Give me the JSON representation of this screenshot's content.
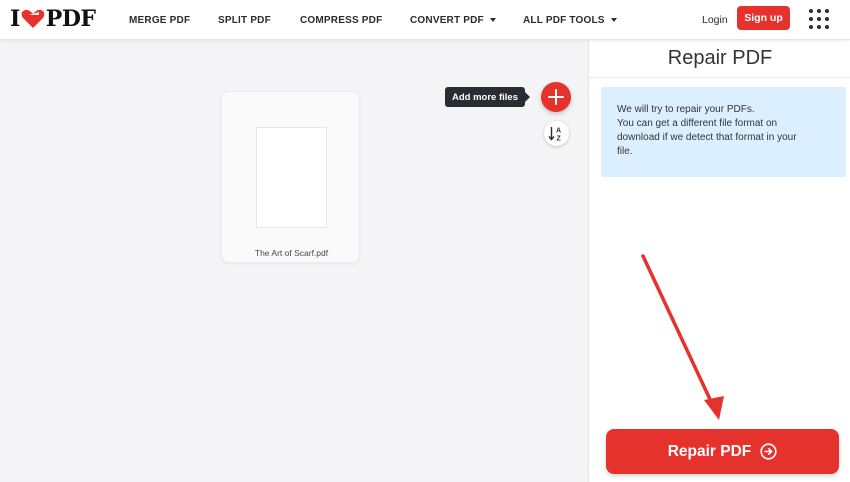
{
  "brand": {
    "logo_left": "I",
    "logo_right": "PDF",
    "accent_color": "#e5322d"
  },
  "nav": {
    "items": [
      {
        "label": "MERGE PDF",
        "has_dropdown": false
      },
      {
        "label": "SPLIT PDF",
        "has_dropdown": false
      },
      {
        "label": "COMPRESS PDF",
        "has_dropdown": false
      },
      {
        "label": "CONVERT PDF",
        "has_dropdown": true
      },
      {
        "label": "ALL PDF TOOLS",
        "has_dropdown": true
      }
    ],
    "login_label": "Login",
    "signup_label": "Sign up",
    "apps_icon": "grid-icon"
  },
  "workspace": {
    "file_name": "The Art of Scarf.pdf",
    "add_files_tooltip": "Add more files",
    "add_icon": "plus-icon",
    "sort_icon": "sort-az-icon"
  },
  "sidebar": {
    "title": "Repair PDF",
    "info_lines": [
      "We will try to repair your PDFs.",
      "You can get a different file format on",
      "download if we detect that format in your",
      "file."
    ],
    "action_label": "Repair PDF",
    "action_icon": "arrow-right-circle-icon",
    "info_bg_color": "#dcefff"
  }
}
